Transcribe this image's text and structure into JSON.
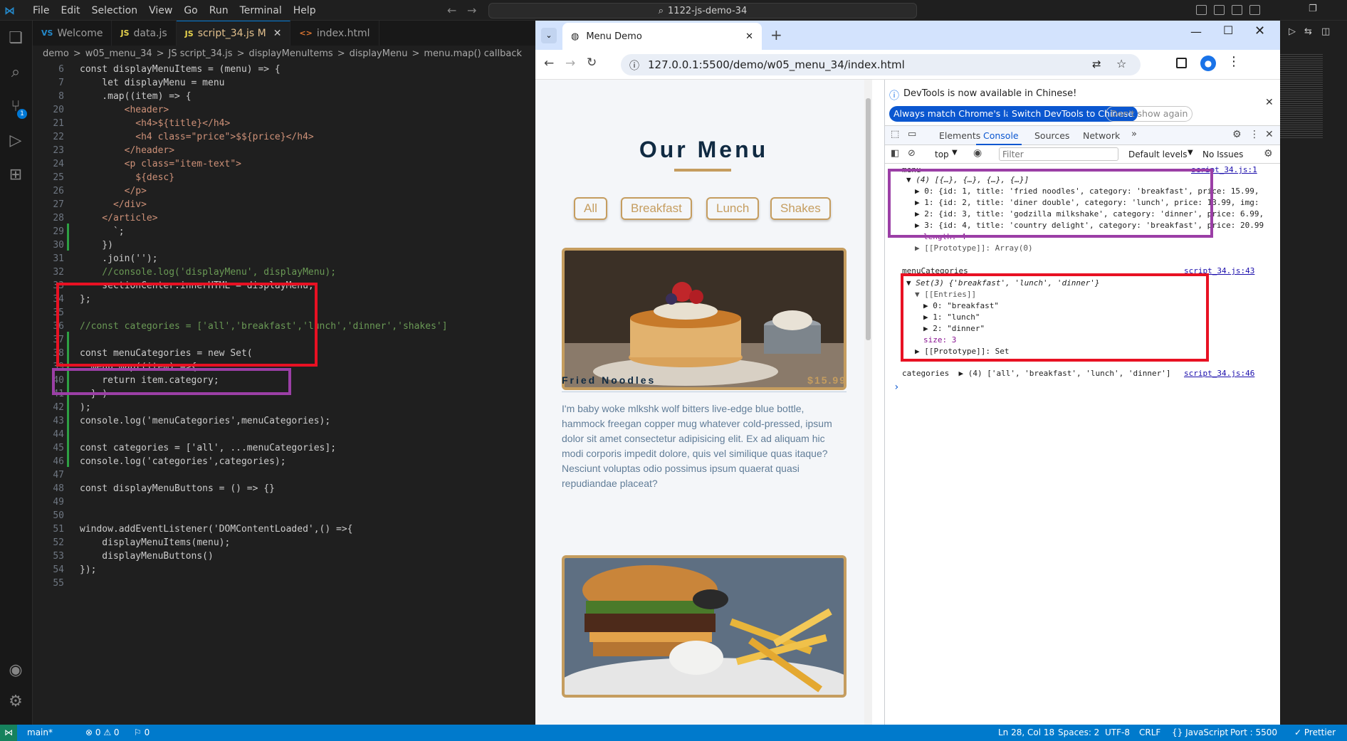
{
  "vscode": {
    "menu": [
      "File",
      "Edit",
      "Selection",
      "View",
      "Go",
      "Run",
      "Terminal",
      "Help"
    ],
    "command_center": "1122-js-demo-34",
    "tabs": [
      {
        "icon": "VS",
        "label": "Welcome"
      },
      {
        "icon": "JS",
        "label": "data.js"
      },
      {
        "icon": "JS",
        "label": "script_34.js M"
      },
      {
        "icon": "<>",
        "label": "index.html"
      }
    ],
    "breadcrumb": [
      "demo",
      ">",
      "w05_menu_34",
      ">",
      "JS script_34.js",
      ">",
      "displayMenuItems",
      ">",
      "displayMenu",
      ">",
      "menu.map() callback"
    ],
    "lines": [
      {
        "n": "6",
        "t": "const displayMenuItems = (menu) => {"
      },
      {
        "n": "7",
        "t": "    let displayMenu = menu"
      },
      {
        "n": "8",
        "t": "    .map((item) => {"
      },
      {
        "n": "20",
        "t": "        <header>"
      },
      {
        "n": "21",
        "t": "          <h4>${title}</h4>"
      },
      {
        "n": "22",
        "t": "          <h4 class=\"price\">$${price}</h4>"
      },
      {
        "n": "23",
        "t": "        </header>"
      },
      {
        "n": "24",
        "t": "        <p class=\"item-text\">"
      },
      {
        "n": "25",
        "t": "          ${desc}"
      },
      {
        "n": "26",
        "t": "        </p>"
      },
      {
        "n": "27",
        "t": "      </div>"
      },
      {
        "n": "28",
        "t": "    </article>"
      },
      {
        "n": "29",
        "t": "      `;"
      },
      {
        "n": "30",
        "t": "    })"
      },
      {
        "n": "31",
        "t": "    .join('');"
      },
      {
        "n": "32",
        "t": "    //console.log('displayMenu', displayMenu);"
      },
      {
        "n": "33",
        "t": "    sectionCenter.innerHTML = displayMenu;"
      },
      {
        "n": "34",
        "t": "};"
      },
      {
        "n": "35",
        "t": ""
      },
      {
        "n": "36",
        "t": "//const categories = ['all','breakfast','lunch','dinner','shakes']"
      },
      {
        "n": "37",
        "t": ""
      },
      {
        "n": "38",
        "t": "const menuCategories = new Set("
      },
      {
        "n": "39",
        "t": "  menu.map((item) =>{"
      },
      {
        "n": "40",
        "t": "    return item.category;"
      },
      {
        "n": "41",
        "t": "  } )"
      },
      {
        "n": "42",
        "t": ");"
      },
      {
        "n": "43",
        "t": "console.log('menuCategories',menuCategories);"
      },
      {
        "n": "44",
        "t": ""
      },
      {
        "n": "45",
        "t": "const categories = ['all', ...menuCategories];"
      },
      {
        "n": "46",
        "t": "console.log('categories',categories);"
      },
      {
        "n": "47",
        "t": ""
      },
      {
        "n": "48",
        "t": "const displayMenuButtons = () => {}"
      },
      {
        "n": "49",
        "t": ""
      },
      {
        "n": "50",
        "t": ""
      },
      {
        "n": "51",
        "t": "window.addEventListener('DOMContentLoaded',() =>{"
      },
      {
        "n": "52",
        "t": "    displayMenuItems(menu);"
      },
      {
        "n": "53",
        "t": "    displayMenuButtons()"
      },
      {
        "n": "54",
        "t": "});"
      },
      {
        "n": "55",
        "t": ""
      }
    ],
    "status": {
      "branch": "main*",
      "errors": "⊗ 0 ⚠ 0",
      "ports": "⚐ 0",
      "position": "Ln 28, Col 18",
      "spaces": "Spaces: 2",
      "encoding": "UTF-8",
      "eol": "CRLF",
      "language": "{} JavaScript",
      "port": "Port : 5500",
      "prettier": "✓ Prettier"
    },
    "highlight_red": "#e81123",
    "highlight_purple": "#9b3fa6"
  },
  "browser": {
    "tab_title": "Menu Demo",
    "url": "127.0.0.1:5500/demo/w05_menu_34/index.html",
    "page": {
      "title": "Our Menu",
      "filters": [
        "All",
        "Breakfast",
        "Lunch",
        "Shakes"
      ],
      "item1": {
        "name": "Fried Noodles",
        "price": "$15.99",
        "desc": "I'm baby woke mlkshk wolf bitters live-edge blue bottle, hammock freegan copper mug whatever cold-pressed, ipsum dolor sit amet consectetur adipisicing elit. Ex ad aliquam hic modi corporis impedit dolore, quis vel similique quas itaque? Nesciunt voluptas odio possimus ipsum quaerat quasi repudiandae placeat?"
      }
    },
    "devtools": {
      "banner": "DevTools is now available in Chinese!",
      "banner_buttons": [
        "Always match Chrome's language",
        "Switch DevTools to Chinese",
        "Don't show again"
      ],
      "tabs": [
        "Elements",
        "Console",
        "Sources",
        "Network"
      ],
      "context": "top",
      "filter_placeholder": "Filter",
      "levels": "Default levels",
      "issues": "No Issues",
      "menu_label": "menu",
      "menu_summary": "▼ (4) [{…}, {…}, {…}, {…}]",
      "menu_rows": [
        "▶ 0: {id: 1, title: 'fried noodles', category: 'breakfast', price: 15.99,",
        "▶ 1: {id: 2, title: 'diner double', category: 'lunch', price: 13.99, img:",
        "▶ 2: {id: 3, title: 'godzilla milkshake', category: 'dinner', price: 6.99,",
        "▶ 3: {id: 4, title: 'country delight', category: 'breakfast', price: 20.99"
      ],
      "menu_length": "length: 4",
      "menu_proto": "▶ [[Prototype]]: Array(0)",
      "menu_src": "script_34.js:1",
      "mc_label": "menuCategories",
      "mc_src": "script_34.js:43",
      "set_summary": "▼ Set(3) {'breakfast', 'lunch', 'dinner'}",
      "entries_label": "▼ [[Entries]]",
      "entries": [
        "▶ 0: \"breakfast\"",
        "▶ 1: \"lunch\"",
        "▶ 2: \"dinner\""
      ],
      "set_size": "size: 3",
      "set_proto": "▶ [[Prototype]]: Set",
      "cat_line": "categories  ▶ (4) ['all', 'breakfast', 'lunch', 'dinner']",
      "cat_src": "script_34.js:46",
      "prompt": "›"
    }
  }
}
